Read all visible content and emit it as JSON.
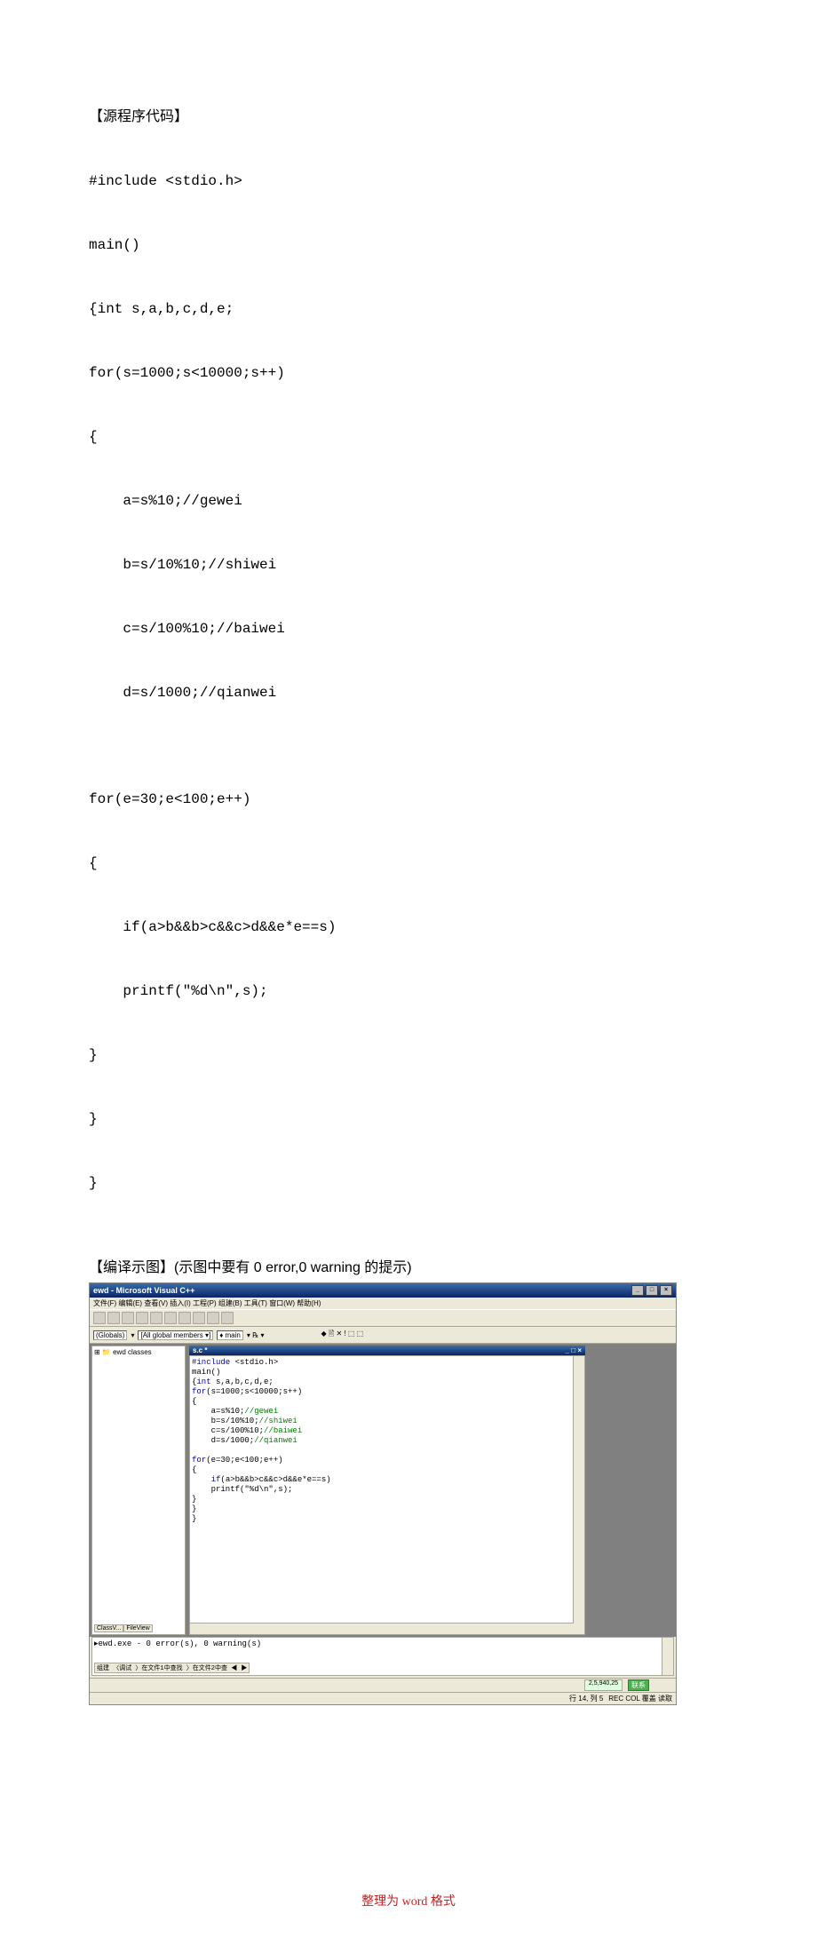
{
  "headings": {
    "source": "【源程序代码】",
    "compile": "【编译示图】(示图中要有 0 error,0 warning 的提示)"
  },
  "source_code": [
    "#include <stdio.h>",
    "main()",
    "{int s,a,b,c,d,e;",
    "for(s=1000;s<10000;s++)",
    "{",
    "    a=s%10;//gewei",
    "    b=s/10%10;//shiwei",
    "    c=s/100%10;//baiwei",
    "    d=s/1000;//qianwei",
    "",
    "for(e=30;e<100;e++)",
    "{",
    "    if(a>b&&b>c&&c>d&&e*e==s)",
    "    printf(\"%d\\n\",s);",
    "}",
    "}",
    "}"
  ],
  "ide": {
    "title": "ewd - Microsoft Visual C++",
    "menu": "文件(F) 编辑(E) 查看(V) 插入(I) 工程(P) 组建(B) 工具(T) 窗口(W) 帮助(H)",
    "combo_globals": "(Globals)",
    "combo_members": "[All global members ▾]",
    "combo_main": "♦ main",
    "tree_root": "ewd classes",
    "tree_tabs": {
      "a": "ClassV...",
      "b": "FileView"
    },
    "editor_tab": "s.c *",
    "output_line": "ewd.exe - 0 error(s), 0 warning(s)",
    "output_tabs": "组建 〈调试 〉在文件1中查找 〉在文件2中查 ◀ ▶",
    "status": {
      "indicator1": "2,5,940,25",
      "btn": "联系",
      "pos": "行 14, 列 5",
      "modes": "REC COL 覆盖 读取"
    }
  },
  "footer": "整理为 word 格式"
}
